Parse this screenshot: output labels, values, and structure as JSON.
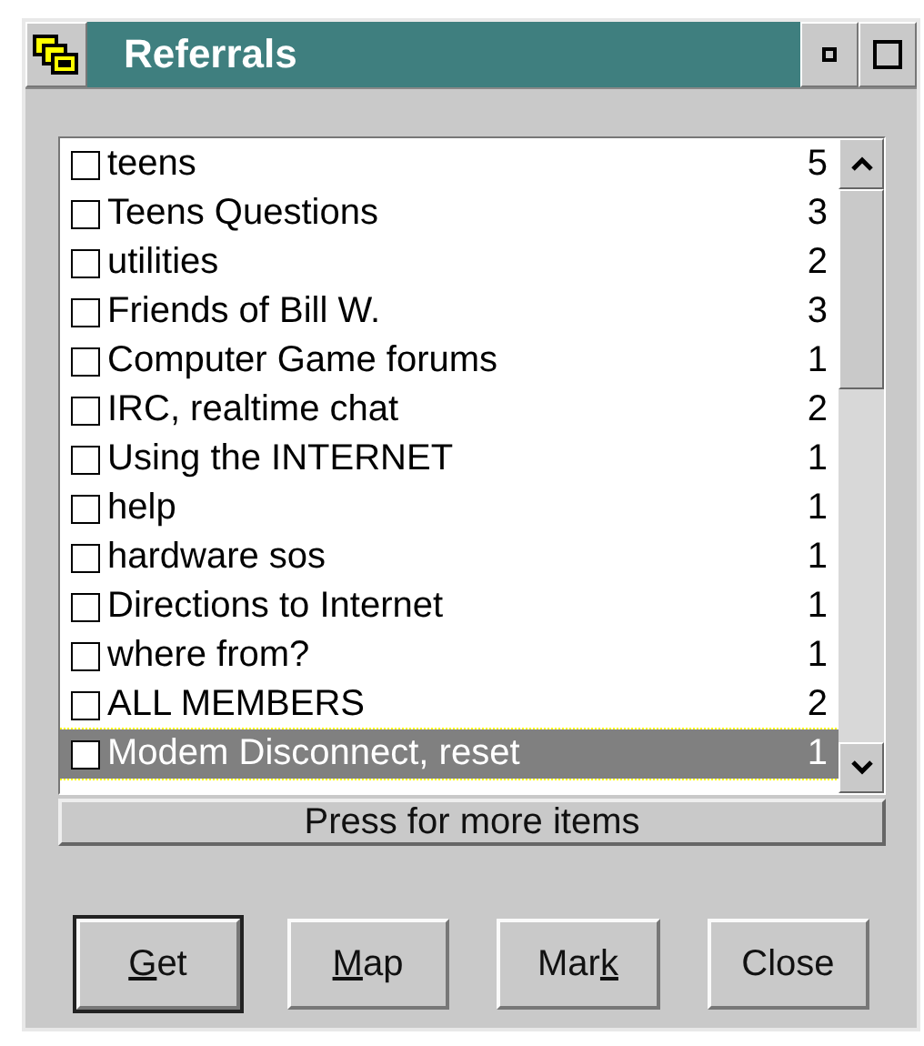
{
  "window": {
    "title": "Referrals"
  },
  "list": {
    "items": [
      {
        "label": "teens",
        "count": "5",
        "checked": false,
        "selected": false
      },
      {
        "label": "Teens Questions",
        "count": "3",
        "checked": false,
        "selected": false
      },
      {
        "label": "utilities",
        "count": "2",
        "checked": false,
        "selected": false
      },
      {
        "label": "Friends of Bill W.",
        "count": "3",
        "checked": false,
        "selected": false
      },
      {
        "label": "Computer Game forums",
        "count": "1",
        "checked": false,
        "selected": false
      },
      {
        "label": "IRC, realtime chat",
        "count": "2",
        "checked": false,
        "selected": false
      },
      {
        "label": "Using the INTERNET",
        "count": "1",
        "checked": false,
        "selected": false
      },
      {
        "label": "help",
        "count": "1",
        "checked": false,
        "selected": false
      },
      {
        "label": "hardware sos",
        "count": "1",
        "checked": false,
        "selected": false
      },
      {
        "label": "Directions to Internet",
        "count": "1",
        "checked": false,
        "selected": false
      },
      {
        "label": "where from?",
        "count": "1",
        "checked": false,
        "selected": false
      },
      {
        "label": "ALL MEMBERS",
        "count": "2",
        "checked": false,
        "selected": false
      },
      {
        "label": "Modem Disconnect, reset",
        "count": "1",
        "checked": false,
        "selected": true
      }
    ]
  },
  "more_button": {
    "label": "Press for more items"
  },
  "buttons": [
    {
      "parts": [
        {
          "text": "G",
          "underlined": true
        },
        {
          "text": "et",
          "underlined": false
        }
      ],
      "default": true
    },
    {
      "parts": [
        {
          "text": "M",
          "underlined": true
        },
        {
          "text": "ap",
          "underlined": false
        }
      ],
      "default": false
    },
    {
      "parts": [
        {
          "text": "Mar",
          "underlined": false
        },
        {
          "text": "k",
          "underlined": true
        }
      ],
      "default": false
    },
    {
      "parts": [
        {
          "text": "Close",
          "underlined": false
        }
      ],
      "default": false
    }
  ]
}
